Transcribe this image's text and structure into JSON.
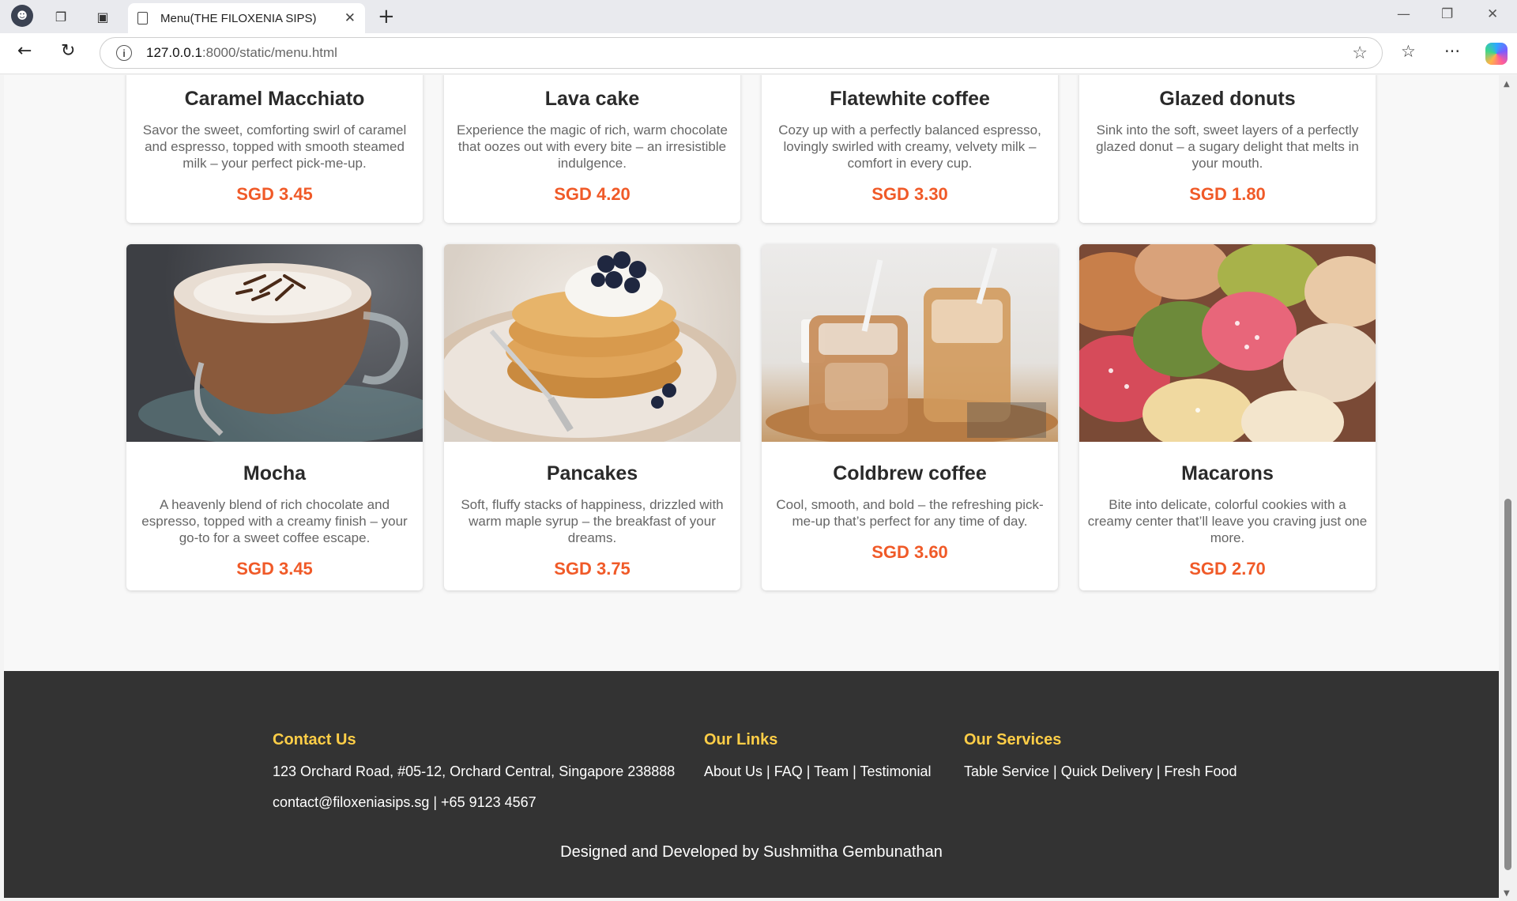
{
  "browser": {
    "tab_title": "Menu(THE FILOXENIA SIPS)",
    "url_host": "127.0.0.1",
    "url_path": ":8000/static/menu.html"
  },
  "menu": {
    "row1": [
      {
        "name": "Caramel Macchiato",
        "desc": "Savor the sweet, comforting swirl of caramel and espresso, topped with smooth steamed milk – your perfect pick-me-up.",
        "price": "SGD 3.45"
      },
      {
        "name": "Lava cake",
        "desc": "Experience the magic of rich, warm chocolate that oozes out with every bite – an irresistible indulgence.",
        "price": "SGD 4.20"
      },
      {
        "name": "Flatewhite coffee",
        "desc": "Cozy up with a perfectly balanced espresso, lovingly swirled with creamy, velvety milk – comfort in every cup.",
        "price": "SGD 3.30"
      },
      {
        "name": "Glazed donuts",
        "desc": "Sink into the soft, sweet layers of a perfectly glazed donut – a sugary delight that melts in your mouth.",
        "price": "SGD 1.80"
      }
    ],
    "row2": [
      {
        "name": "Mocha",
        "desc": "A heavenly blend of rich chocolate and espresso, topped with a creamy finish – your go-to for a sweet coffee escape.",
        "price": "SGD 3.45"
      },
      {
        "name": "Pancakes",
        "desc": "Soft, fluffy stacks of happiness, drizzled with warm maple syrup – the breakfast of your dreams.",
        "price": "SGD 3.75"
      },
      {
        "name": "Coldbrew coffee",
        "desc": "Cool, smooth, and bold – the refreshing pick-me-up that’s perfect for any time of day.",
        "price": "SGD 3.60"
      },
      {
        "name": "Macarons",
        "desc": "Bite into delicate, colorful cookies with a creamy center that’ll leave you craving just one more.",
        "price": "SGD 2.70"
      }
    ]
  },
  "footer": {
    "contact": {
      "heading": "Contact Us",
      "address": "123 Orchard Road, #05-12, Orchard Central, Singapore 238888",
      "email_phone": "contact@filoxeniasips.sg | +65 9123 4567"
    },
    "links": {
      "heading": "Our Links",
      "items": "About Us | FAQ | Team | Testimonial"
    },
    "services": {
      "heading": "Our Services",
      "items": "Table Service | Quick Delivery | Fresh Food"
    },
    "credit": "Designed and Developed by Sushmitha Gembunathan"
  },
  "colors": {
    "price": "#f05a28",
    "footer_bg": "#333333",
    "footer_heading": "#ffce47"
  }
}
